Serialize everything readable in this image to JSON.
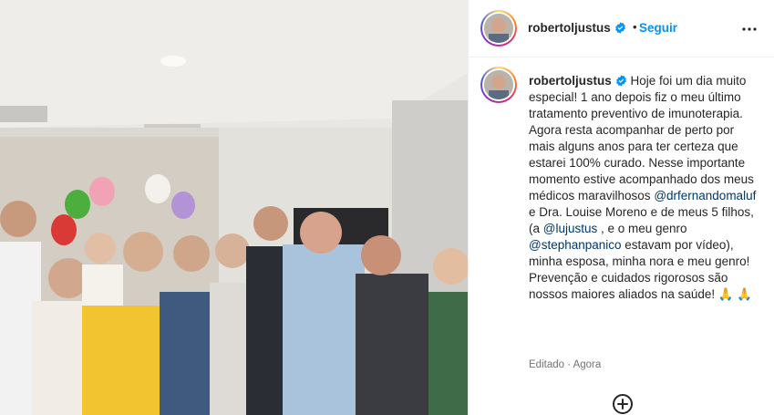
{
  "post": {
    "username": "robertoljustus",
    "dot": "•",
    "follow_label": "Seguir",
    "caption": {
      "intro": "Hoje foi um dia muito especial! 1 ano depois fiz o meu último tratamento preventivo de imunoterapia. Agora resta acompanhar de perto por mais alguns anos para ter certeza que estarei 100% curado. Nesse importante momento estive acompanhado dos meus médicos maravilhosos ",
      "mention1": "@drfernandomaluf",
      "text2": " e Dra. Louise Moreno e de meus 5 filhos, (a ",
      "mention2": "@lujustus",
      "text3": " , e o meu genro ",
      "mention3": "@stephanpanico",
      "text4": " estavam por vídeo), minha esposa, minha nora e meu genro! Prevenção e cuidados rigorosos são nossos maiores aliados na saúde! 🙏 🙏"
    },
    "meta": "Editado · Agora"
  },
  "icons": {
    "verified": "verified-badge-icon",
    "more": "more-options-icon",
    "add": "add-comment-icon"
  },
  "colors": {
    "follow": "#0095f6",
    "mention": "#00376b",
    "verified": "#0095f6"
  }
}
